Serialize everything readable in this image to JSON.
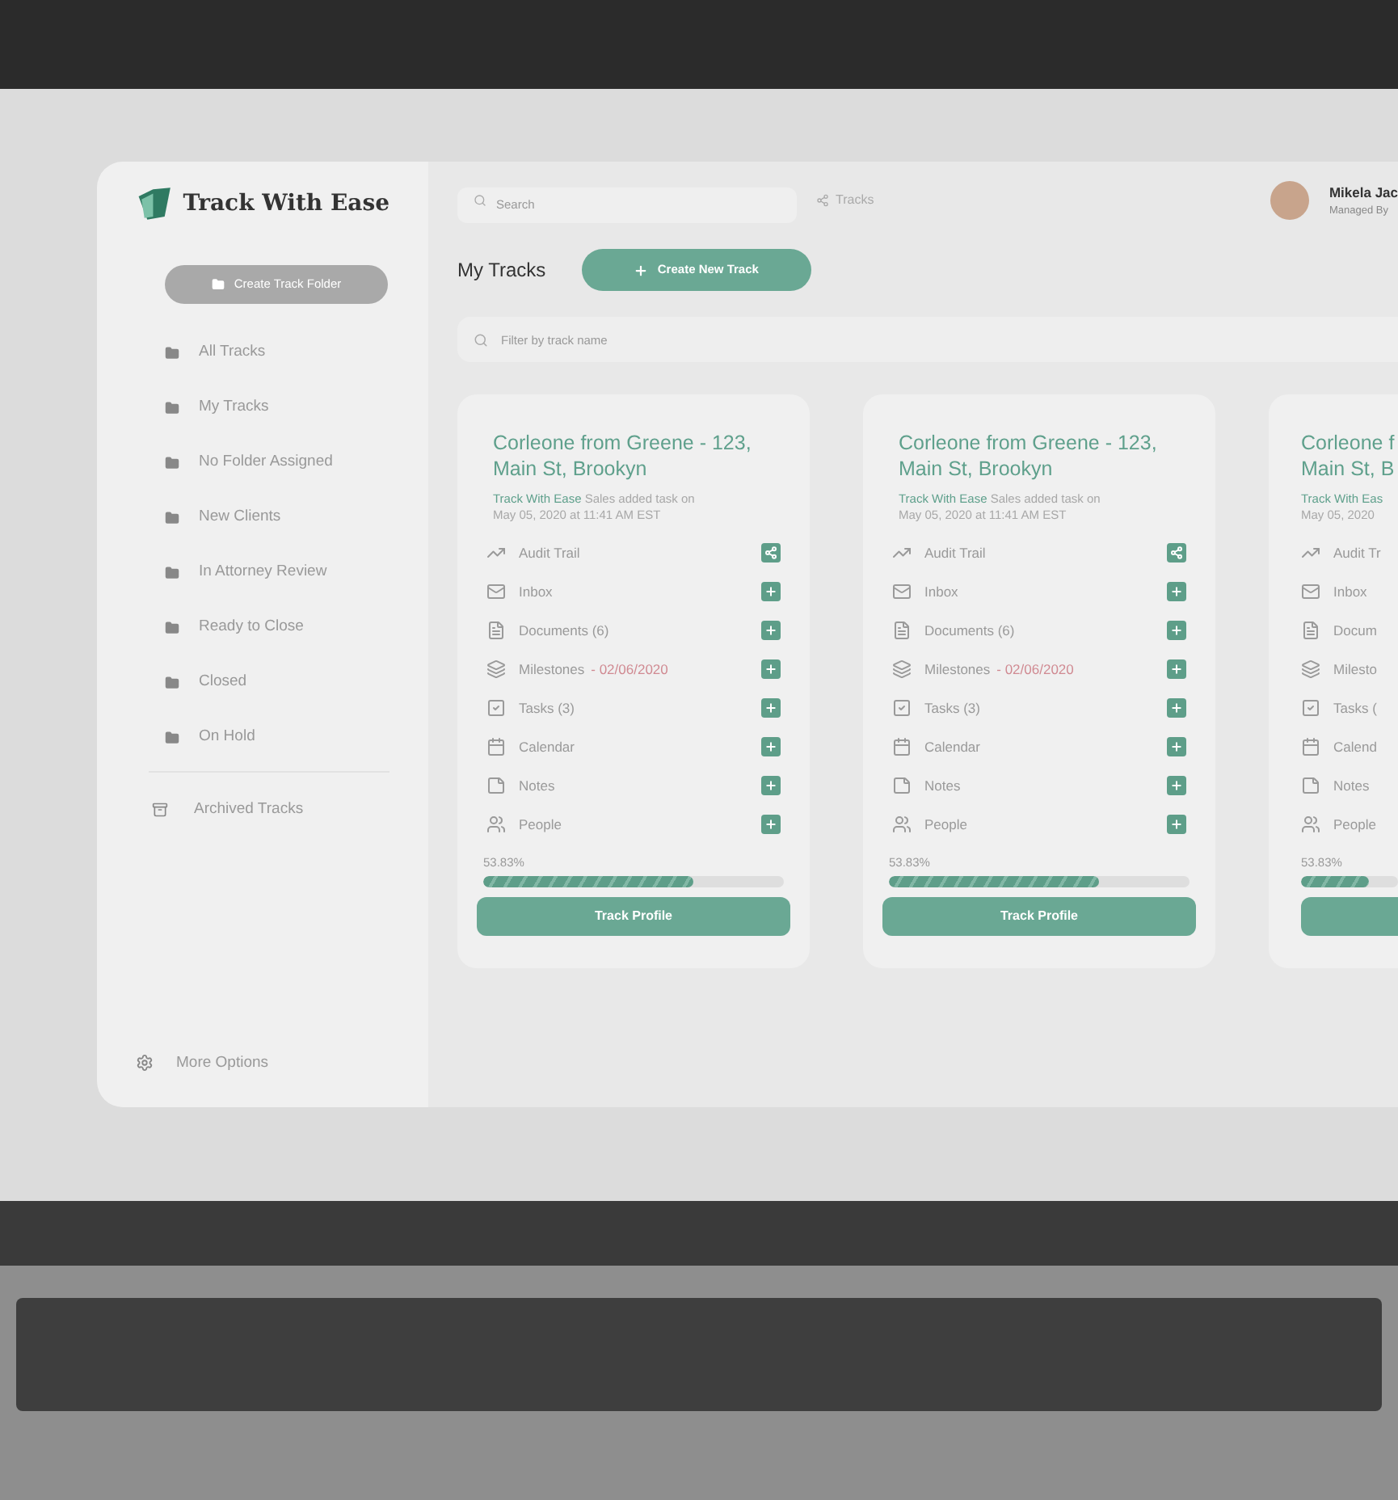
{
  "app": {
    "logo_text": "Track With Ease"
  },
  "sidebar": {
    "create_button": "Create Track Folder",
    "folders": [
      {
        "label": "All Tracks"
      },
      {
        "label": "My Tracks"
      },
      {
        "label": "No Folder Assigned"
      },
      {
        "label": "New Clients"
      },
      {
        "label": "In Attorney Review"
      },
      {
        "label": "Ready to Close"
      },
      {
        "label": "Closed"
      },
      {
        "label": "On Hold"
      }
    ],
    "archived": "Archived Tracks",
    "more_options": "More Options"
  },
  "top_bar": {
    "search_placeholder": "Search",
    "breadcrumb": "Tracks",
    "user_name": "Mikela Jac",
    "user_role": "Managed By"
  },
  "page": {
    "title": "My Tracks",
    "create_button": "Create New Track",
    "filter_placeholder": "Filter by track name"
  },
  "cards": [
    {
      "title_lines": [
        "Corleone from Greene -  123,",
        "Main St, Brookyn"
      ],
      "byline": [
        {
          "author": "Track With Ease",
          "text": "Sales added task on"
        },
        {
          "text": "May 05, 2020 at 11:41 AM EST"
        }
      ],
      "items": [
        {
          "label": "Audit Trail",
          "kind": "share"
        },
        {
          "label": "Inbox",
          "kind": "add"
        },
        {
          "label": "Documents (6)",
          "kind": "add"
        },
        {
          "label": "Milestones",
          "date": "- 02/06/2020",
          "kind": "add"
        },
        {
          "label": "Tasks (3)",
          "kind": "add"
        },
        {
          "label": "Calendar",
          "kind": "add"
        },
        {
          "label": "Notes",
          "kind": "add"
        },
        {
          "label": "People",
          "kind": "add"
        }
      ],
      "progress_text": "53.83%",
      "level": 0.7,
      "button": "Track Profile"
    },
    {
      "title_lines": [
        "Corleone from Greene -  123,",
        "Main St, Brookyn"
      ],
      "byline": [
        {
          "author": "Track With Ease",
          "text": "Sales added task on"
        },
        {
          "text": "May 05, 2020 at 11:41 AM EST"
        }
      ],
      "items": [
        {
          "label": "Audit Trail",
          "kind": "share"
        },
        {
          "label": "Inbox",
          "kind": "add"
        },
        {
          "label": "Documents (6)",
          "kind": "add"
        },
        {
          "label": "Milestones",
          "date": "- 02/06/2020",
          "kind": "add"
        },
        {
          "label": "Tasks (3)",
          "kind": "add"
        },
        {
          "label": "Calendar",
          "kind": "add"
        },
        {
          "label": "Notes",
          "kind": "add"
        },
        {
          "label": "People",
          "kind": "add"
        }
      ],
      "progress_text": "53.83%",
      "level": 0.7,
      "button": "Track Profile"
    },
    {
      "title_lines": [
        "Corleone f",
        "Main St, B"
      ],
      "byline": [
        {
          "author": "Track With Eas"
        },
        {
          "text": "May 05, 2020"
        }
      ],
      "items": [
        {
          "label": "Audit Tr",
          "kind": "plain"
        },
        {
          "label": "Inbox",
          "kind": "plain"
        },
        {
          "label": "Docum",
          "kind": "plain"
        },
        {
          "label": "Milesto",
          "kind": "plain"
        },
        {
          "label": "Tasks (",
          "kind": "plain"
        },
        {
          "label": "Calend",
          "kind": "plain"
        },
        {
          "label": "Notes",
          "kind": "plain"
        },
        {
          "label": "People",
          "kind": "plain"
        }
      ],
      "progress_text": "53.83%",
      "level": 0.7
    }
  ]
}
